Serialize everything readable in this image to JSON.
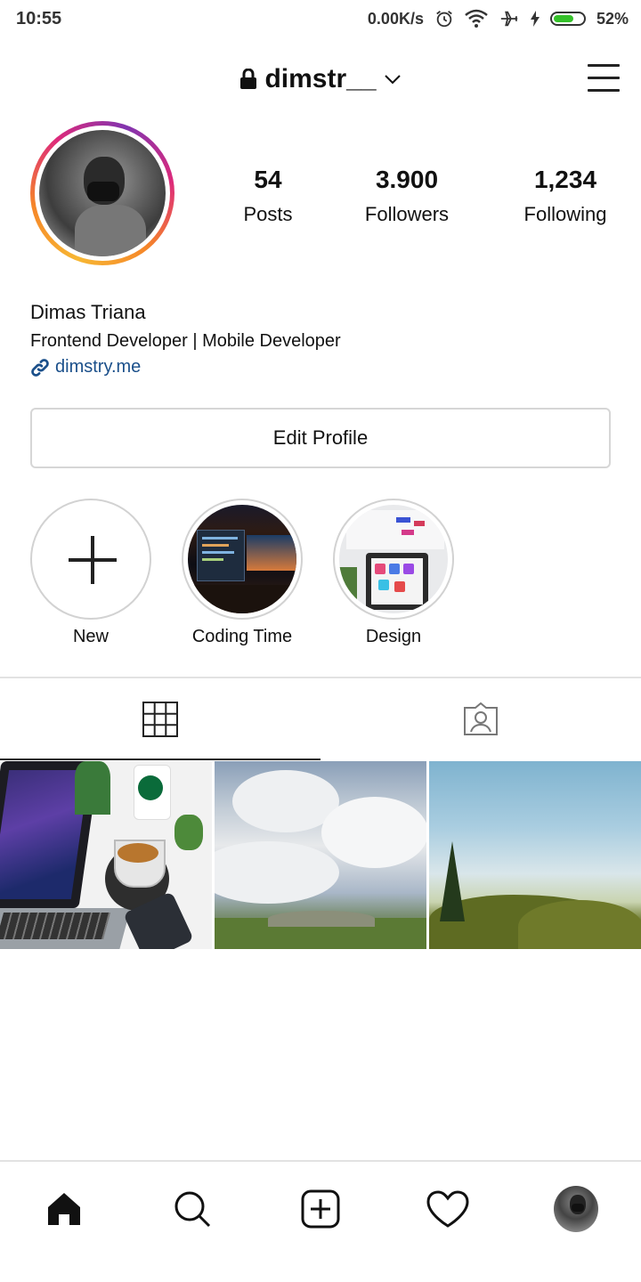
{
  "status_bar": {
    "time": "10:55",
    "network_speed": "0.00K/s",
    "battery": "52%",
    "icons": [
      "alarm-icon",
      "wifi-icon",
      "airplane-icon",
      "charging-icon",
      "battery-icon"
    ]
  },
  "header": {
    "username": "dimstr__",
    "icons": [
      "lock-icon",
      "chevron-down-icon",
      "menu-icon"
    ]
  },
  "profile": {
    "stats": [
      {
        "value": "54",
        "label": "Posts"
      },
      {
        "value": "3.900",
        "label": "Followers"
      },
      {
        "value": "1,234",
        "label": "Following"
      }
    ],
    "name": "Dimas Triana",
    "bio": "Frontend Developer | Mobile Developer",
    "link": "dimstry.me",
    "edit_button": "Edit Profile"
  },
  "highlights": [
    {
      "label": "New"
    },
    {
      "label": "Coding Time"
    },
    {
      "label": "Design"
    }
  ],
  "tabs": [
    "grid-icon",
    "tagged-icon"
  ],
  "bottom_nav": [
    "home-icon",
    "search-icon",
    "add-post-icon",
    "heart-icon",
    "profile-avatar"
  ],
  "colors": {
    "link": "#1a4f8a",
    "battery_fill": "#35c12a",
    "ring_gradient": [
      "#f7b733",
      "#f58529",
      "#dd2a7b",
      "#8134af"
    ]
  }
}
